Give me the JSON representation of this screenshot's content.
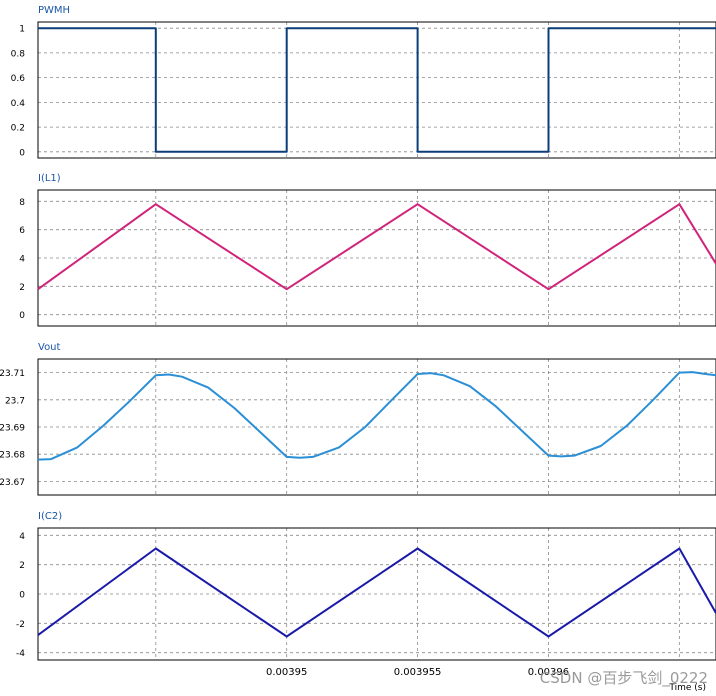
{
  "watermark": "CSDN @百步飞剑_0222",
  "colors": {
    "pwmh": "#0b3d7a",
    "il1": "#d0237a",
    "vout": "#2b8fd6",
    "ic2": "#1a1aa8",
    "title": "#1a56a6",
    "grid": "#8a8a8a",
    "frame": "#000000"
  },
  "chart_data": [
    {
      "type": "line",
      "title": "PWMH",
      "series": [
        {
          "x": [
            0.0039405,
            0.003945,
            0.003945,
            0.00395,
            0.00395,
            0.003955,
            0.003955,
            0.00396,
            0.00396,
            0.0039664
          ],
          "y": [
            1,
            1,
            0,
            0,
            1,
            1,
            0,
            0,
            1,
            1
          ]
        }
      ],
      "ylim": [
        -0.05,
        1.05
      ],
      "yticks": [
        0,
        0.2,
        0.4,
        0.6,
        0.8,
        1
      ],
      "yticklabels": [
        "0",
        "0.2",
        "0.4",
        "0.6",
        "0.8",
        "1"
      ]
    },
    {
      "type": "line",
      "title": "I(L1)",
      "series": [
        {
          "x": [
            0.0039405,
            0.003945,
            0.00395,
            0.003955,
            0.00396,
            0.003965,
            0.0039664
          ],
          "y": [
            1.8,
            7.8,
            1.8,
            7.8,
            1.8,
            7.8,
            3.6
          ]
        }
      ],
      "ylim": [
        -0.8,
        8.8
      ],
      "yticks": [
        0,
        2,
        4,
        6,
        8
      ],
      "yticklabels": [
        "0",
        "2",
        "4",
        "6",
        "8"
      ]
    },
    {
      "type": "line",
      "title": "Vout",
      "series": [
        {
          "x": [
            0.0039405,
            0.003941,
            0.003942,
            0.003943,
            0.003944,
            0.003945,
            0.0039455,
            0.003946,
            0.003947,
            0.003948,
            0.003949,
            0.00395,
            0.0039505,
            0.003951,
            0.003952,
            0.003953,
            0.003954,
            0.003955,
            0.0039555,
            0.003956,
            0.003957,
            0.003958,
            0.003959,
            0.00396,
            0.0039605,
            0.003961,
            0.003962,
            0.003963,
            0.003964,
            0.003965,
            0.0039655,
            0.003966,
            0.0039664
          ],
          "y": [
            23.678,
            23.6782,
            23.6825,
            23.6905,
            23.6995,
            23.709,
            23.7093,
            23.7085,
            23.7045,
            23.697,
            23.688,
            23.679,
            23.6787,
            23.679,
            23.6825,
            23.69,
            23.6998,
            23.7095,
            23.7098,
            23.709,
            23.705,
            23.6975,
            23.6885,
            23.6795,
            23.6792,
            23.6795,
            23.683,
            23.6905,
            23.7,
            23.71,
            23.7102,
            23.7095,
            23.709
          ]
        }
      ],
      "ylim": [
        23.665,
        23.715
      ],
      "yticks": [
        23.67,
        23.68,
        23.69,
        23.7,
        23.71
      ],
      "yticklabels": [
        "23.67",
        "23.68",
        "23.69",
        "23.7",
        "23.71"
      ]
    },
    {
      "type": "line",
      "title": "I(C2)",
      "series": [
        {
          "x": [
            0.0039405,
            0.003945,
            0.00395,
            0.003955,
            0.00396,
            0.003965,
            0.0039664
          ],
          "y": [
            -2.8,
            3.1,
            -2.9,
            3.1,
            -2.9,
            3.1,
            -1.3
          ]
        }
      ],
      "ylim": [
        -4.5,
        4.5
      ],
      "yticks": [
        -4,
        -2,
        0,
        2,
        4
      ],
      "yticklabels": [
        "-4",
        "-2",
        "0",
        "2",
        "4"
      ]
    }
  ],
  "xaxis": {
    "xlim": [
      0.0039405,
      0.0039664
    ],
    "xticks": [
      0.00395,
      0.003955,
      0.00396
    ],
    "xticklabels": [
      "0.00395",
      "0.003955",
      "0.00396"
    ],
    "gridlines": [
      0.003945,
      0.00395,
      0.003955,
      0.00396,
      0.003965
    ],
    "xlabel": "Time (s)"
  },
  "grid": true
}
